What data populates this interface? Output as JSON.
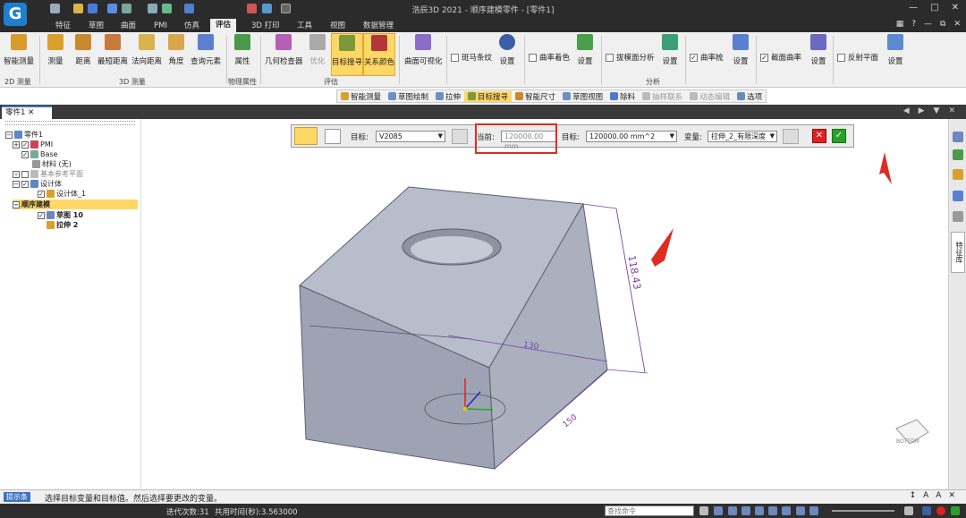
{
  "app": {
    "title": "浩辰3D 2021 - 顺序建模零件 - [零件1]",
    "logo": "G"
  },
  "menu_tabs": [
    "特征",
    "草图",
    "曲面",
    "PMI",
    "仿真",
    "评估",
    "3D 打印",
    "工具",
    "视图",
    "数据管理"
  ],
  "active_tab": "评估",
  "ribbon": {
    "buttons": [
      "智能测量",
      "测量",
      "距离",
      "最短距离",
      "法向距离",
      "角度",
      "查询元素",
      "属性",
      "几何检查器",
      "优化",
      "目标搜寻",
      "关系颜色",
      "曲面可视化"
    ],
    "groups": [
      "2D 测量",
      "3D 测量",
      "物理属性",
      "评估",
      "分析"
    ],
    "checks": [
      "斑马条纹",
      "曲率着色",
      "拔模面分析",
      "曲率梳",
      "截面曲率",
      "反射平面"
    ],
    "settings_label": "设置"
  },
  "quicktools": [
    "智能测量",
    "草图绘制",
    "拉伸",
    "目标搜寻",
    "智能尺寸",
    "草图视图",
    "除料",
    "抽样联系",
    "动态编辑",
    "选项"
  ],
  "doc_tab": "零件1",
  "tree": {
    "root": "零件1",
    "pmi": "PMI",
    "base": "Base",
    "material": "材料 (无)",
    "ref_planes": "基本参考平面",
    "design_body": "设计体",
    "design_body_1": "设计体_1",
    "ordered": "顺序建模",
    "sketch": "草图 10",
    "extrude": "拉伸 2"
  },
  "cmdbar": {
    "target_label": "目标:",
    "target_value": "V2085",
    "current_label": "当前:",
    "current_value": "120000.00 mm",
    "target2_label": "目标:",
    "target2_value": "120000.00 mm^2",
    "variable_label": "变量:",
    "variable_value": "拉伸_2_有限深度"
  },
  "dims": {
    "height": "118.43",
    "width": "130",
    "depth": "150"
  },
  "side_tab": "特征库",
  "viewcube": "BOTTOM",
  "status": {
    "label": "提示条",
    "message": "选择目标变量和目标值。然后选择要更改的变量。",
    "search_placeholder": "查找命令"
  },
  "bottom": {
    "iterations": "迭代次数:31",
    "time": "共用时间(秒):3.563000"
  },
  "colors": {
    "accent": "#ffd767",
    "titlebar": "#2b2b2b",
    "highlight_red": "#e02b20",
    "dim_purple": "#7a3fb0",
    "model_face": "#aab0be"
  }
}
